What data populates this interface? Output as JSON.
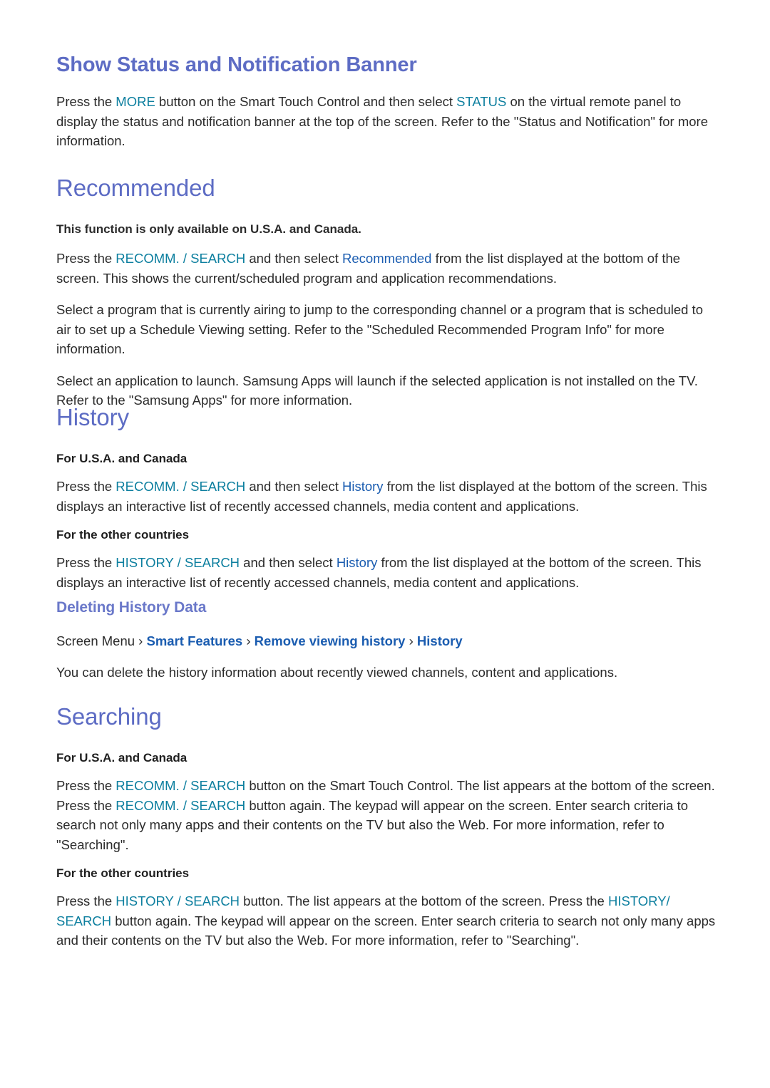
{
  "colors": {
    "heading": "#5d6cc4",
    "subheading": "#6a78c9",
    "button_token": "#0d7f9f",
    "menu_token": "#1a5cb0",
    "body_text": "#2b2b2b",
    "background": "#ffffff"
  },
  "sections": {
    "show_status": {
      "title": "Show Status and Notification Banner",
      "paragraph": {
        "p1": "Press the ",
        "tok1": "MORE",
        "p2": " button on the Smart Touch Control and then select ",
        "tok2": "STATUS",
        "p3": " on the virtual remote panel to display the status and notification banner at the top of the screen. Refer to the \"Status and Notification\" for more information."
      }
    },
    "recommended": {
      "title": "Recommended",
      "note": "This function is only available on U.S.A. and Canada.",
      "paragraph1": {
        "p1": "Press the ",
        "tok1": "RECOMM. / SEARCH",
        "p2": " and then select ",
        "tok2": "Recommended",
        "p3": " from the list displayed at the bottom of the screen. This shows the current/scheduled program and application recommendations."
      },
      "paragraph2": "Select a program that is currently airing to jump to the corresponding channel or a program that is scheduled to air to set up a Schedule Viewing setting. Refer to the \"Scheduled Recommended Program Info\" for more information.",
      "paragraph3": "Select an application to launch. Samsung Apps will launch if the selected application is not installed on the TV. Refer to the \"Samsung Apps\" for more information."
    },
    "history": {
      "title": "History",
      "lead_usa": "For U.S.A. and Canada",
      "paragraph_usa": {
        "p1": "Press the ",
        "tok1": "RECOMM. / SEARCH",
        "p2": " and then select ",
        "tok2": "History",
        "p3": " from the list displayed at the bottom of the screen. This displays an interactive list of recently accessed channels, media content and applications."
      },
      "lead_other": "For the other countries",
      "paragraph_other": {
        "p1": "Press the ",
        "tok1": "HISTORY / SEARCH",
        "p2": " and then select ",
        "tok2": "History",
        "p3": " from the list displayed at the bottom of the screen. This displays an interactive list of recently accessed channels, media content and applications."
      },
      "deleting": {
        "title": "Deleting History Data",
        "breadcrumb": {
          "root": "Screen Menu",
          "sep": " › ",
          "item1": "Smart Features",
          "item2": "Remove viewing history",
          "item3": "History"
        },
        "paragraph": "You can delete the history information about recently viewed channels, content and applications."
      }
    },
    "searching": {
      "title": "Searching",
      "lead_usa": "For U.S.A. and Canada",
      "paragraph_usa": {
        "p1": "Press the ",
        "tok1": "RECOMM. / SEARCH",
        "p2": " button on the Smart Touch Control. The list appears at the bottom of the screen. Press the ",
        "tok2": "RECOMM. / SEARCH",
        "p3": " button again. The keypad will appear on the screen. Enter search criteria to search not only many apps and their contents on the TV but also the Web. For more information, refer to \"Searching\"."
      },
      "lead_other": "For the other countries",
      "paragraph_other": {
        "p1": "Press the ",
        "tok1": "HISTORY / SEARCH",
        "p2": " button. The list appears at the bottom of the screen. Press the ",
        "tok2": "HISTORY",
        "p3": "",
        "tok3": "/ SEARCH",
        "p4": " button again. The keypad will appear on the screen. Enter search criteria to search not only many apps and their contents on the TV but also the Web. For more information, refer to \"Searching\"."
      }
    }
  }
}
